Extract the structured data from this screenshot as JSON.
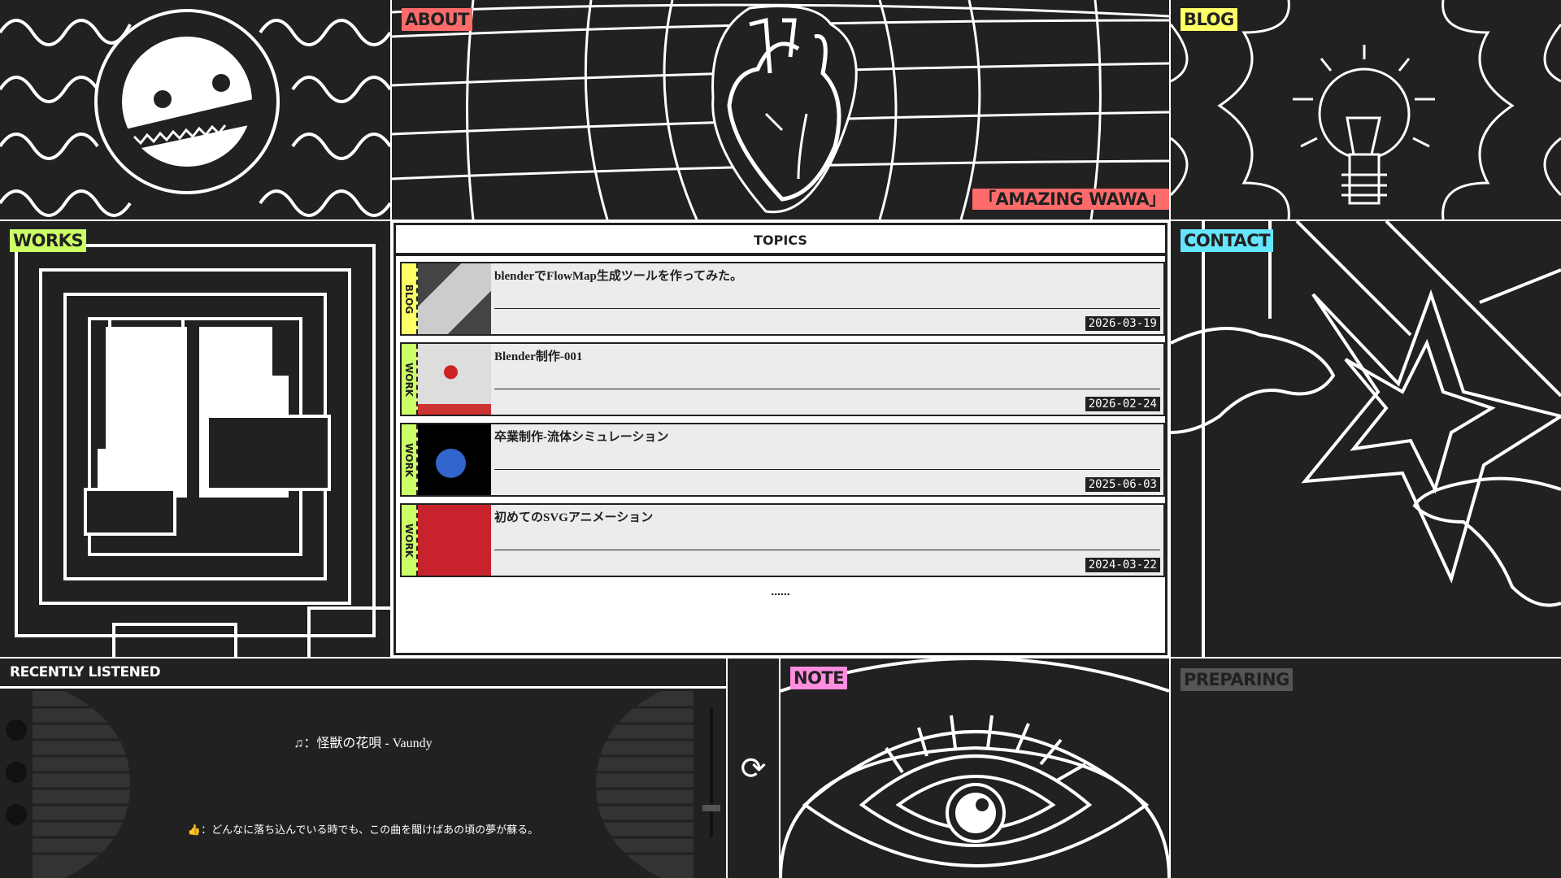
{
  "logo": {
    "text": "AMAZING WAWA"
  },
  "tiles": {
    "about": "ABOUT",
    "about_subtitle": "「AMAZING WAWA」",
    "blog": "BLOG",
    "works": "WORKS",
    "contact": "CONTACT",
    "note": "NOTE",
    "preparing": "PREPARING"
  },
  "colors": {
    "about": "#ff6b6b",
    "blog": "#ffff66",
    "works": "#ccff66",
    "contact": "#66e5ff",
    "note": "#ff8de0",
    "preparing": "#555555",
    "bg": "#212121"
  },
  "topics": {
    "title": "TOPICS",
    "items": [
      {
        "category": "BLOG",
        "title": "blenderでFlowMap生成ツールを作ってみた。",
        "date": "2026-03-19"
      },
      {
        "category": "WORK",
        "title": "Blender制作-001",
        "date": "2026-02-24"
      },
      {
        "category": "WORK",
        "title": "卒業制作-流体シミュレーション",
        "date": "2025-06-03"
      },
      {
        "category": "WORK",
        "title": "初めてのSVGアニメーション",
        "date": "2024-03-22"
      }
    ],
    "more": "......"
  },
  "listened": {
    "title": "RECENTLY LISTENED",
    "song": "：怪獣の花唄 - Vaundy",
    "comment": "：どんなに落ち込んでいる時でも、この曲を聞けばあの頃の夢が蘇る。"
  }
}
